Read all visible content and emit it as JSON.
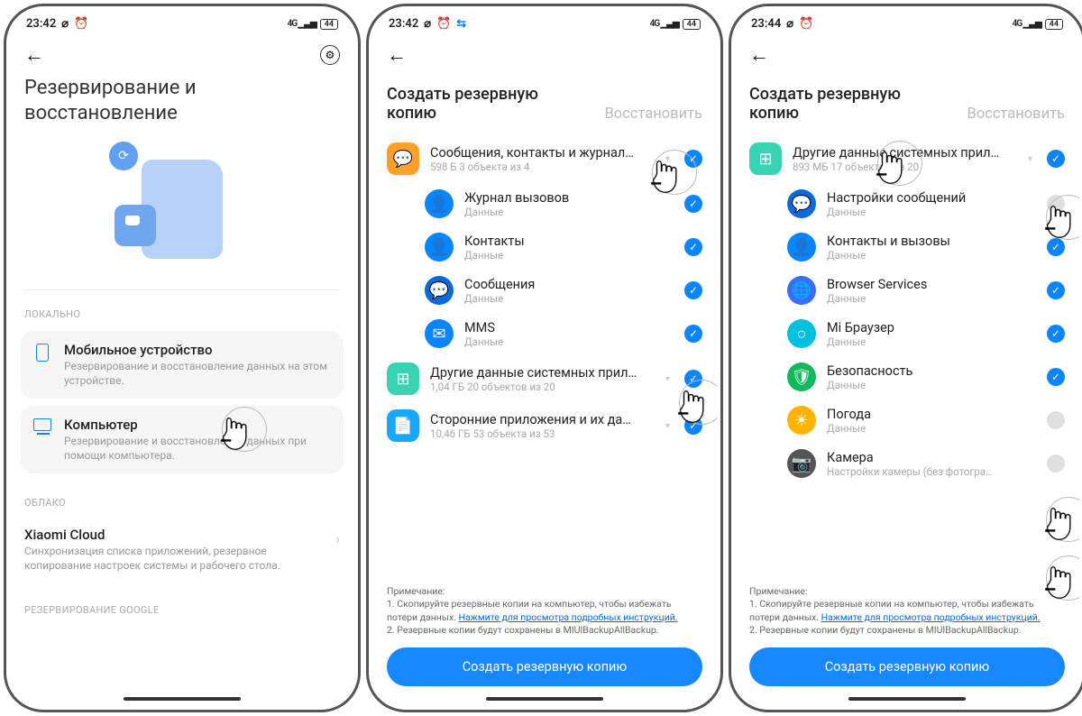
{
  "screen1": {
    "status": {
      "time": "23:42",
      "network": "4G",
      "battery": "44"
    },
    "title": "Резервирование и восстановление",
    "section_local": "ЛОКАЛЬНО",
    "mobile": {
      "title": "Мобильное устройство",
      "desc": "Резервирование и восстановление данных на этом устройстве."
    },
    "pc": {
      "title": "Компьютер",
      "desc": "Резервирование и восстановление данных при помощи компьютера."
    },
    "section_cloud": "ОБЛАКО",
    "cloud": {
      "title": "Xiaomi Cloud",
      "desc": "Синхронизация списка приложений, резервное копирование настроек системы и рабочего стола."
    },
    "section_google": "РЕЗЕРВИРОВАНИЕ GOOGLE"
  },
  "screen2": {
    "status": {
      "time": "23:42",
      "network": "4G",
      "battery": "44"
    },
    "tab_backup": "Создать резервную копию",
    "tab_restore": "Восстановить",
    "group1": {
      "title": "Сообщения, контакты и журнал…",
      "sub": "598 Б   3 объекта из 4"
    },
    "items": [
      {
        "title": "Журнал вызовов",
        "sub": "Данные"
      },
      {
        "title": "Контакты",
        "sub": "Данные"
      },
      {
        "title": "Сообщения",
        "sub": "Данные"
      },
      {
        "title": "MMS",
        "sub": "Данные"
      }
    ],
    "group2": {
      "title": "Другие данные системных прил…",
      "sub": "1,04 ГБ   20 объектов из 20"
    },
    "group3": {
      "title": "Сторонние приложения и их да…",
      "sub": "10,46 ГБ   53 объекта из 53"
    },
    "note_label": "Примечание:",
    "note1": "1. Скопируйте резервные копии на компьютер, чтобы избежать потери данных. ",
    "note_link": "Нажмите для просмотра подробных инструкций.",
    "note2": "2. Резервные копии будут сохранены в MIUIBackupAllBackup.",
    "cta": "Создать резервную копию"
  },
  "screen3": {
    "status": {
      "time": "23:44",
      "network": "4G",
      "battery": "44"
    },
    "tab_backup": "Создать резервную копию",
    "tab_restore": "Восстановить",
    "group": {
      "title": "Другие данные системных прил…",
      "sub": "893 МБ   17 объектов из 20"
    },
    "items": [
      {
        "title": "Настройки сообщений",
        "sub": "Данные",
        "checked": false
      },
      {
        "title": "Контакты и вызовы",
        "sub": "Данные",
        "checked": true
      },
      {
        "title": "Browser Services",
        "sub": "Данные",
        "checked": true
      },
      {
        "title": "Mi Браузер",
        "sub": "Данные",
        "checked": true
      },
      {
        "title": "Безопасность",
        "sub": "Данные",
        "checked": true
      },
      {
        "title": "Погода",
        "sub": "Данные",
        "checked": false
      },
      {
        "title": "Камера",
        "sub": "Настройки камеры (без фотогра…",
        "checked": false
      }
    ],
    "note_label": "Примечание:",
    "note1": "1. Скопируйте резервные копии на компьютер, чтобы избежать потери данных. ",
    "note_link": "Нажмите для просмотра подробных инструкций.",
    "note2": "2. Резервные копии будут сохранены в MIUIBackupAllBackup.",
    "cta": "Создать резервную копию"
  }
}
